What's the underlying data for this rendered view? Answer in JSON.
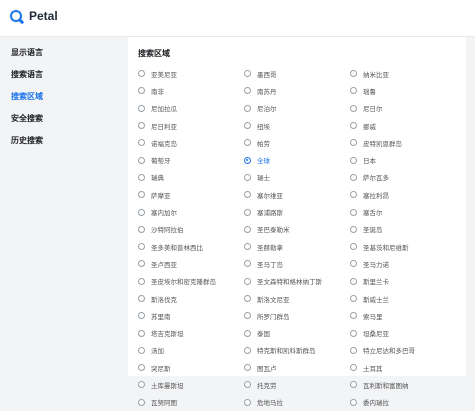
{
  "app": {
    "name": "Petal"
  },
  "sidebar": {
    "items": [
      {
        "label": "显示语言",
        "active": false
      },
      {
        "label": "搜索语言",
        "active": false
      },
      {
        "label": "搜索区域",
        "active": true
      },
      {
        "label": "安全搜索",
        "active": false
      },
      {
        "label": "历史搜索",
        "active": false
      }
    ]
  },
  "section": {
    "title": "搜索区域"
  },
  "regions": [
    {
      "label": "亚美尼亚",
      "selected": false
    },
    {
      "label": "墨西哥",
      "selected": false
    },
    {
      "label": "纳米比亚",
      "selected": false
    },
    {
      "label": "南非",
      "selected": false
    },
    {
      "label": "南苏丹",
      "selected": false
    },
    {
      "label": "瑙鲁",
      "selected": false
    },
    {
      "label": "尼加拉瓜",
      "selected": false
    },
    {
      "label": "尼泊尔",
      "selected": false
    },
    {
      "label": "尼日尔",
      "selected": false
    },
    {
      "label": "尼日利亚",
      "selected": false
    },
    {
      "label": "纽埃",
      "selected": false
    },
    {
      "label": "挪威",
      "selected": false
    },
    {
      "label": "诺福克岛",
      "selected": false
    },
    {
      "label": "帕劳",
      "selected": false
    },
    {
      "label": "皮特凯恩群岛",
      "selected": false
    },
    {
      "label": "葡萄牙",
      "selected": false
    },
    {
      "label": "全球",
      "selected": true
    },
    {
      "label": "日本",
      "selected": false
    },
    {
      "label": "瑞典",
      "selected": false
    },
    {
      "label": "瑞士",
      "selected": false
    },
    {
      "label": "萨尔瓦多",
      "selected": false
    },
    {
      "label": "萨摩亚",
      "selected": false
    },
    {
      "label": "塞尔维亚",
      "selected": false
    },
    {
      "label": "塞拉利昂",
      "selected": false
    },
    {
      "label": "塞内加尔",
      "selected": false
    },
    {
      "label": "塞浦路斯",
      "selected": false
    },
    {
      "label": "塞舌尔",
      "selected": false
    },
    {
      "label": "沙特阿拉伯",
      "selected": false
    },
    {
      "label": "圣巴泰勒米",
      "selected": false
    },
    {
      "label": "圣诞岛",
      "selected": false
    },
    {
      "label": "圣多美和普林西比",
      "selected": false
    },
    {
      "label": "圣赫勒拿",
      "selected": false
    },
    {
      "label": "圣基茨和尼维斯",
      "selected": false
    },
    {
      "label": "圣卢西亚",
      "selected": false
    },
    {
      "label": "圣马丁岛",
      "selected": false
    },
    {
      "label": "圣马力诺",
      "selected": false
    },
    {
      "label": "圣皮埃尔和密克隆群岛",
      "selected": false
    },
    {
      "label": "圣文森特和格林纳丁斯",
      "selected": false
    },
    {
      "label": "斯里兰卡",
      "selected": false
    },
    {
      "label": "斯洛伐克",
      "selected": false
    },
    {
      "label": "斯洛文尼亚",
      "selected": false
    },
    {
      "label": "斯威士兰",
      "selected": false
    },
    {
      "label": "苏里南",
      "selected": false
    },
    {
      "label": "所罗门群岛",
      "selected": false
    },
    {
      "label": "索马里",
      "selected": false
    },
    {
      "label": "塔吉克斯坦",
      "selected": false
    },
    {
      "label": "泰国",
      "selected": false
    },
    {
      "label": "坦桑尼亚",
      "selected": false
    },
    {
      "label": "汤加",
      "selected": false
    },
    {
      "label": "特克斯和凯科斯群岛",
      "selected": false
    },
    {
      "label": "特立尼达和多巴哥",
      "selected": false
    },
    {
      "label": "突尼斯",
      "selected": false
    },
    {
      "label": "图瓦卢",
      "selected": false
    },
    {
      "label": "土耳其",
      "selected": false
    },
    {
      "label": "土库曼斯坦",
      "selected": false
    },
    {
      "label": "托克劳",
      "selected": false
    },
    {
      "label": "瓦利斯和富图纳",
      "selected": false
    },
    {
      "label": "瓦努阿图",
      "selected": false
    },
    {
      "label": "危地马拉",
      "selected": false
    },
    {
      "label": "委内瑞拉",
      "selected": false
    }
  ]
}
